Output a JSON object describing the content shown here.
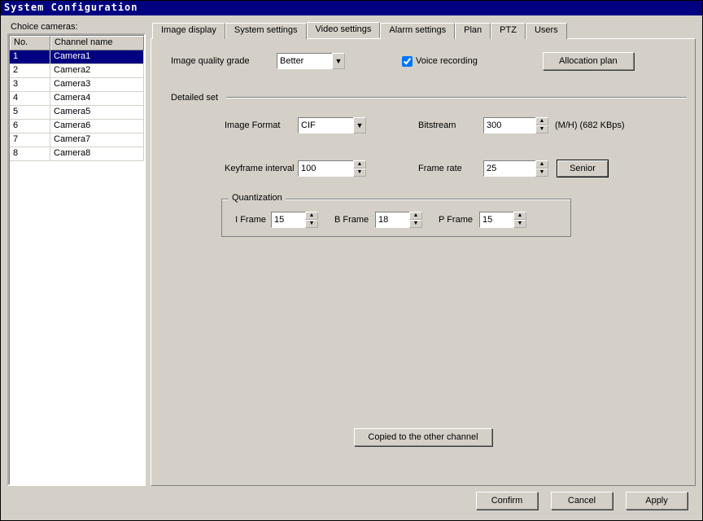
{
  "window": {
    "title": "System Configuration"
  },
  "left": {
    "label": "Choice cameras:",
    "columns": {
      "no": "No.",
      "name": "Channel name"
    },
    "rows": [
      {
        "no": "1",
        "name": "Camera1",
        "selected": true
      },
      {
        "no": "2",
        "name": "Camera2"
      },
      {
        "no": "3",
        "name": "Camera3"
      },
      {
        "no": "4",
        "name": "Camera4"
      },
      {
        "no": "5",
        "name": "Camera5"
      },
      {
        "no": "6",
        "name": "Camera6"
      },
      {
        "no": "7",
        "name": "Camera7"
      },
      {
        "no": "8",
        "name": "Camera8"
      }
    ]
  },
  "tabs": [
    {
      "label": "Image display"
    },
    {
      "label": "System settings"
    },
    {
      "label": "Video settings",
      "active": true
    },
    {
      "label": "Alarm settings"
    },
    {
      "label": "Plan"
    },
    {
      "label": "PTZ"
    },
    {
      "label": "Users"
    }
  ],
  "video": {
    "image_quality_label": "Image quality grade",
    "image_quality_value": "Better",
    "voice_recording_label": "Voice recording",
    "voice_recording_checked": true,
    "allocation_btn": "Allocation plan",
    "detailed_set_label": "Detailed set",
    "image_format_label": "Image Format",
    "image_format_value": "CIF",
    "bitstream_label": "Bitstream",
    "bitstream_value": "300",
    "bitstream_unit": "(M/H)  (682 KBps)",
    "keyframe_label": "Keyframe interval",
    "keyframe_value": "100",
    "framerate_label": "Frame rate",
    "framerate_value": "25",
    "senior_btn": "Senior",
    "quantization_label": "Quantization",
    "iframe_label": "I Frame",
    "iframe_value": "15",
    "bframe_label": "B Frame",
    "bframe_value": "18",
    "pframe_label": "P Frame",
    "pframe_value": "15",
    "copy_btn": "Copied to the other channel"
  },
  "footer": {
    "confirm": "Confirm",
    "cancel": "Cancel",
    "apply": "Apply"
  }
}
